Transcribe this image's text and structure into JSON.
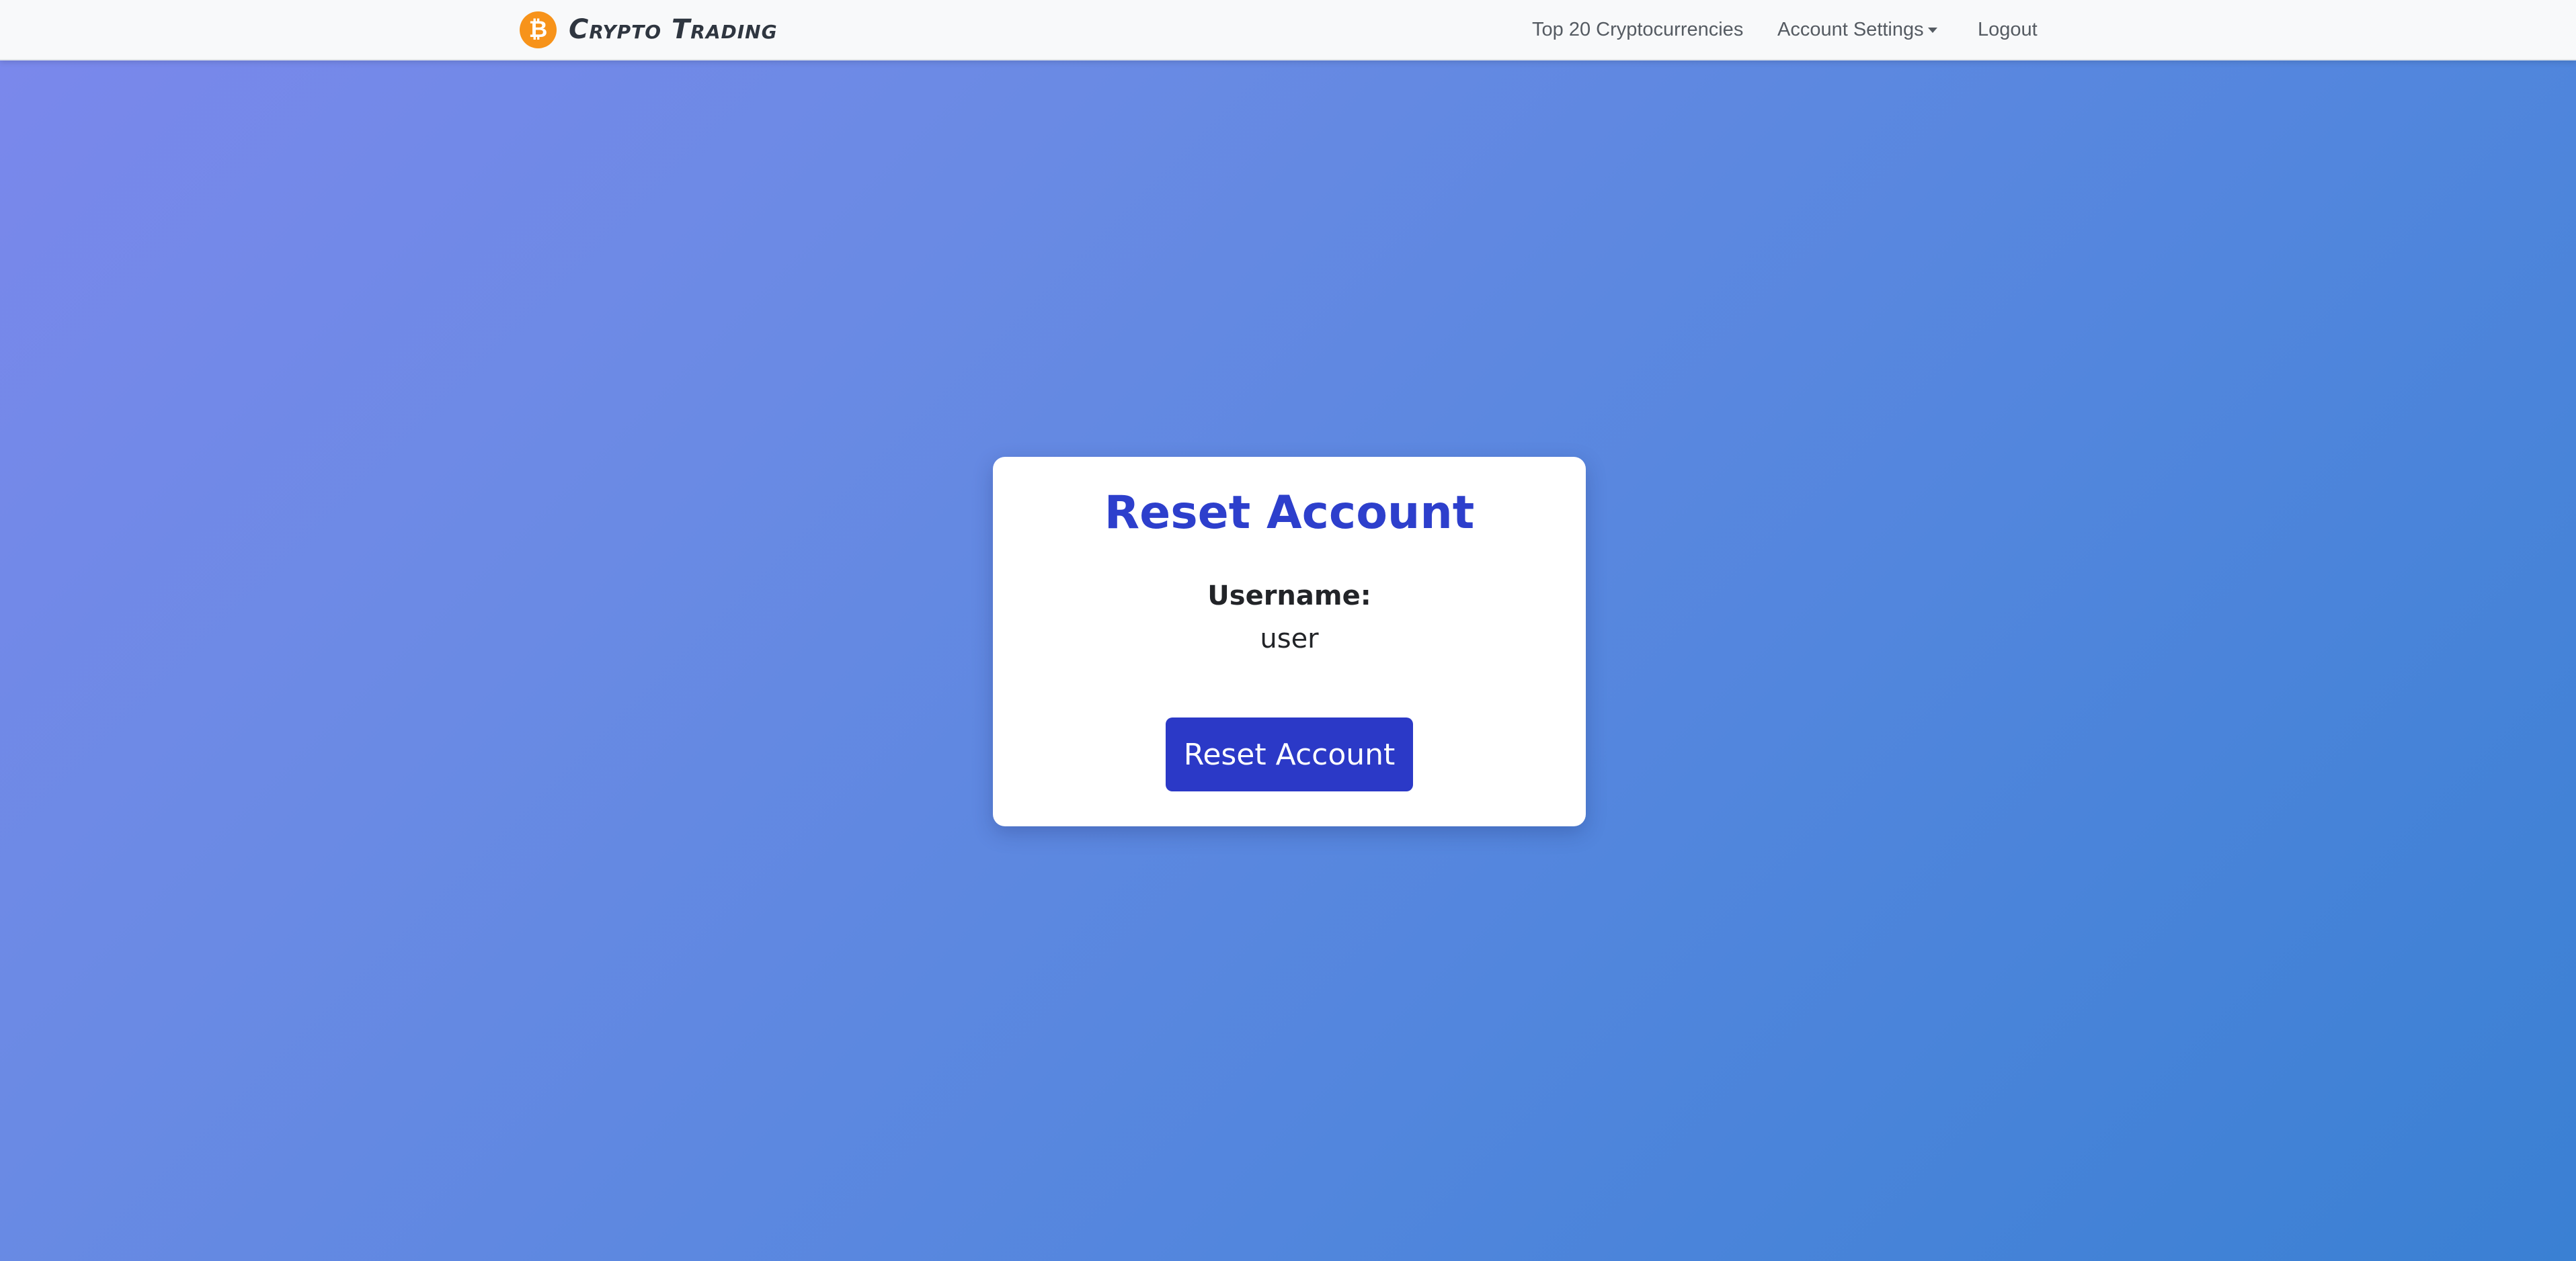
{
  "navbar": {
    "brand_logo_symbol": "₿",
    "brand_logo_icon": "bitcoin-icon",
    "brand_name": "Crypto Trading",
    "links": {
      "top20": "Top 20 Cryptocurrencies",
      "account_settings": "Account Settings",
      "logout": "Logout"
    }
  },
  "card": {
    "title": "Reset Account",
    "username_label": "Username:",
    "username_value": "user",
    "reset_button_label": "Reset Account"
  },
  "colors": {
    "accent": "#2b39c7",
    "title": "#2d3fcc",
    "bitcoin_orange": "#f7931a",
    "gradient_start": "#7b88ec",
    "gradient_end": "#3a80d3"
  }
}
